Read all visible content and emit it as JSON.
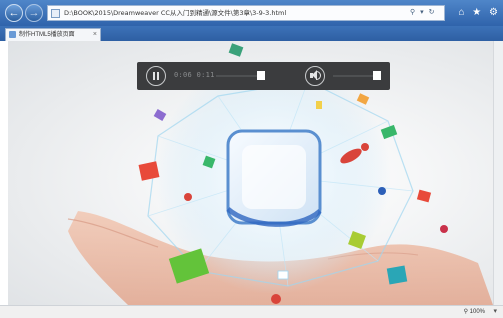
{
  "browser": {
    "address": "D:\\BOOK\\2015\\Dreamweaver CC从入门到精通\\源文件\\第3章\\3-9-3.html",
    "tab_title": "制作HTML5播放页面",
    "zoom": "100%"
  },
  "icons": {
    "back": "back-arrow-icon",
    "forward": "forward-arrow-icon",
    "search": "search-icon",
    "refresh": "refresh-icon",
    "home": "home-icon",
    "favorites": "star-icon",
    "settings": "gear-icon",
    "play_pause": "pause-icon",
    "volume": "speaker-icon"
  },
  "player": {
    "time": "0:06 0:11",
    "progress": 0.9,
    "volume": 1.0
  },
  "colors": {
    "chrome": "#2f63ab",
    "controls_bg": "#3b3c3e"
  }
}
